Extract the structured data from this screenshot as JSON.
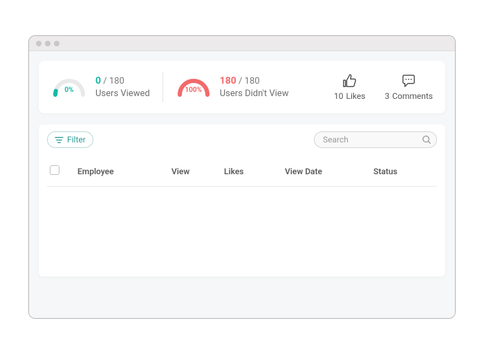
{
  "stats": {
    "viewed": {
      "percent": "0%",
      "count": "0",
      "total": "/ 180",
      "label": "Users Viewed"
    },
    "notviewed": {
      "percent": "100%",
      "count": "180",
      "total": "/ 180",
      "label": "Users Didn't View"
    },
    "likes": {
      "count": "10",
      "label": "Likes"
    },
    "comments": {
      "count": "3",
      "label": "Comments"
    }
  },
  "toolbar": {
    "filter_label": "Filter",
    "search_placeholder": "Search"
  },
  "table": {
    "headers": {
      "employee": "Employee",
      "view": "View",
      "likes": "Likes",
      "view_date": "View Date",
      "status": "Status"
    }
  },
  "colors": {
    "teal": "#16b8a6",
    "red": "#f26a6a"
  }
}
